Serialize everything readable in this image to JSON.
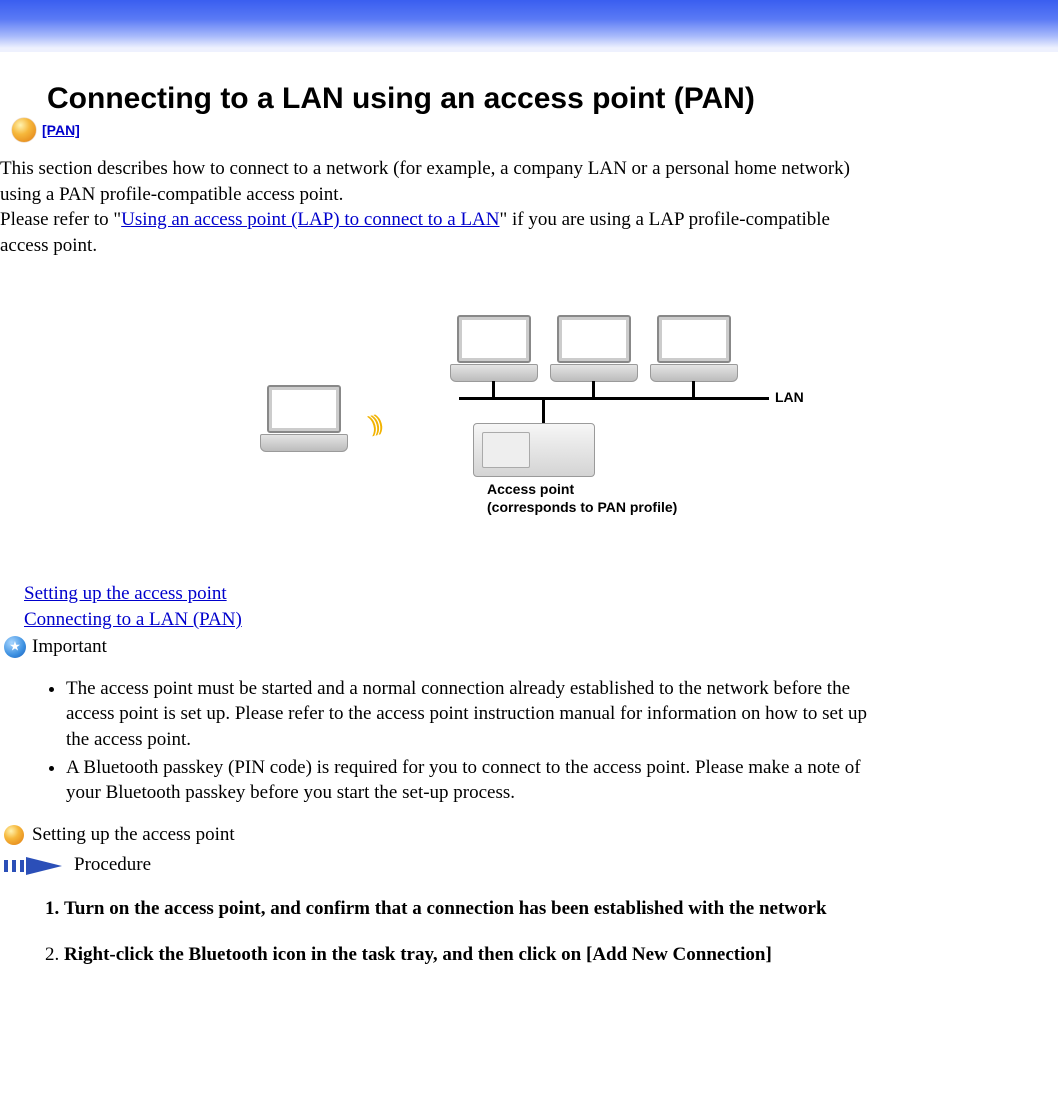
{
  "title": "Connecting to a LAN using an access point (PAN)",
  "pan_link_label": "[PAN]",
  "intro": {
    "p1a": "This section describes how to connect to a network (for example, a company LAN or a personal home network) using a PAN profile-compatible access point.",
    "p2a": "Please refer to \"",
    "p2_link": "Using an access point (LAP) to connect to a LAN",
    "p2b": "\" if you are using a LAP profile-compatible access point."
  },
  "diagram": {
    "lan_label": "LAN",
    "ap_label_1": "Access point",
    "ap_label_2": "(corresponds to PAN profile)"
  },
  "toc": {
    "link1": "Setting up the access point",
    "link2": "Connecting to a LAN (PAN)"
  },
  "important_label": "Important",
  "notes": [
    "The access point must be started and a normal connection already established to the network before the access point is set up. Please refer to the access point instruction manual for information on how to set up the access point.",
    "A Bluetooth passkey (PIN code) is required for you to connect to the access point. Please make a note of your Bluetooth passkey before you start the set-up process."
  ],
  "subhead": "Setting up the access point",
  "procedure_label": "Procedure",
  "steps": [
    "Turn on the access point, and confirm that a connection has been established with the network",
    "Right-click the Bluetooth icon in the task tray, and then click on [Add New Connection]"
  ]
}
